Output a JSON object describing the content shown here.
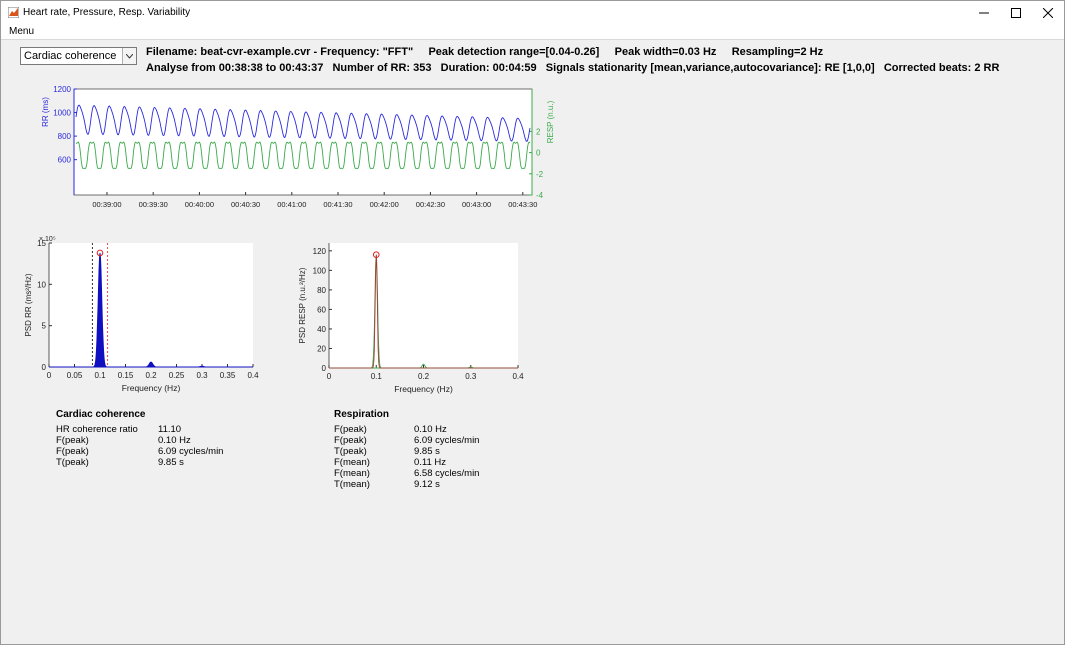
{
  "window": {
    "title": "Heart rate, Pressure, Resp. Variability",
    "menu": [
      "Menu"
    ]
  },
  "toolbar": {
    "analysis_select": "Cardiac coherence",
    "line1": "Filename: beat-cvr-example.cvr - Frequency: \"FFT\"     Peak detection range=[0.04-0.26]     Peak width=0.03 Hz     Resampling=2 Hz",
    "line2": "Analyse from 00:38:38 to 00:43:37   Number of RR: 353   Duration: 00:04:59   Signals stationarity [mean,variance,autocovariance]: RE [1,0,0]   Corrected beats: 2 RR"
  },
  "colors": {
    "rr": "#2a2ae0",
    "resp": "#3aaa4a",
    "peak_marker": "#e02020",
    "window": "#f0f0f0"
  },
  "chart_data": [
    {
      "type": "line",
      "title": "",
      "xlabel": "",
      "x_tick_labels": [
        "00:39:00",
        "00:39:30",
        "00:40:00",
        "00:40:30",
        "00:41:00",
        "00:41:30",
        "00:42:00",
        "00:42:30",
        "00:43:00",
        "00:43:30"
      ],
      "series": [
        {
          "name": "RR",
          "axis": "left",
          "ylabel": "RR (ms)",
          "ylim": [
            300,
            1200
          ],
          "yticks": [
            600,
            800,
            1000,
            1200
          ],
          "oscillations": 30,
          "start_mean": 950,
          "end_mean": 860,
          "start_amplitude": 140,
          "end_amplitude": 110
        },
        {
          "name": "RESP",
          "axis": "right",
          "ylabel": "RESP (n.u.)",
          "ylim": [
            -4,
            6
          ],
          "yticks": [
            -4,
            -2,
            0,
            2
          ],
          "oscillations": 30,
          "mean": 0,
          "amplitude": 1.5
        }
      ]
    },
    {
      "type": "area",
      "ylabel": "PSD RR (ms²/Hz)",
      "xlabel": "Frequency (Hz)",
      "x_ticks": [
        "0",
        "0.05",
        "0.1",
        "0.15",
        "0.2",
        "0.25",
        "0.3",
        "0.35",
        "0.4"
      ],
      "xlim": [
        0,
        0.4
      ],
      "y_ticks": [
        "0",
        "5",
        "10",
        "15"
      ],
      "y_exponent": "× 10⁵",
      "ylim": [
        0,
        15
      ],
      "peak": {
        "f": 0.1,
        "value": 13.8
      },
      "secondary_peaks": [
        {
          "f": 0.2,
          "value": 0.6
        },
        {
          "f": 0.3,
          "value": 0.1
        }
      ],
      "detection_window": [
        0.085,
        0.115
      ]
    },
    {
      "type": "line",
      "ylabel": "PSD RESP (n.u.²/Hz)",
      "xlabel": "Frequency (Hz)",
      "x_ticks": [
        "0",
        "0.1",
        "0.2",
        "0.3",
        "0.4"
      ],
      "xlim": [
        0,
        0.4
      ],
      "y_ticks": [
        "0",
        "20",
        "40",
        "60",
        "80",
        "100",
        "120"
      ],
      "ylim": [
        0,
        128
      ],
      "peak": {
        "f": 0.1,
        "value": 116
      },
      "secondary_peaks": [
        {
          "f": 0.2,
          "value": 4
        },
        {
          "f": 0.3,
          "value": 1
        }
      ]
    }
  ],
  "cardiac_coherence": {
    "title": "Cardiac coherence",
    "rows": [
      {
        "label": "HR coherence ratio",
        "value": "11.10"
      },
      {
        "label": "F(peak)",
        "value": "0.10 Hz"
      },
      {
        "label": "F(peak)",
        "value": "6.09 cycles/min"
      },
      {
        "label": "T(peak)",
        "value": "9.85 s"
      }
    ]
  },
  "respiration": {
    "title": "Respiration",
    "rows": [
      {
        "label": "F(peak)",
        "value": "0.10 Hz"
      },
      {
        "label": "F(peak)",
        "value": "6.09 cycles/min"
      },
      {
        "label": "T(peak)",
        "value": "9.85 s"
      },
      {
        "label": "F(mean)",
        "value": "0.11 Hz"
      },
      {
        "label": "F(mean)",
        "value": "6.58 cycles/min"
      },
      {
        "label": "T(mean)",
        "value": "9.12 s"
      }
    ]
  }
}
